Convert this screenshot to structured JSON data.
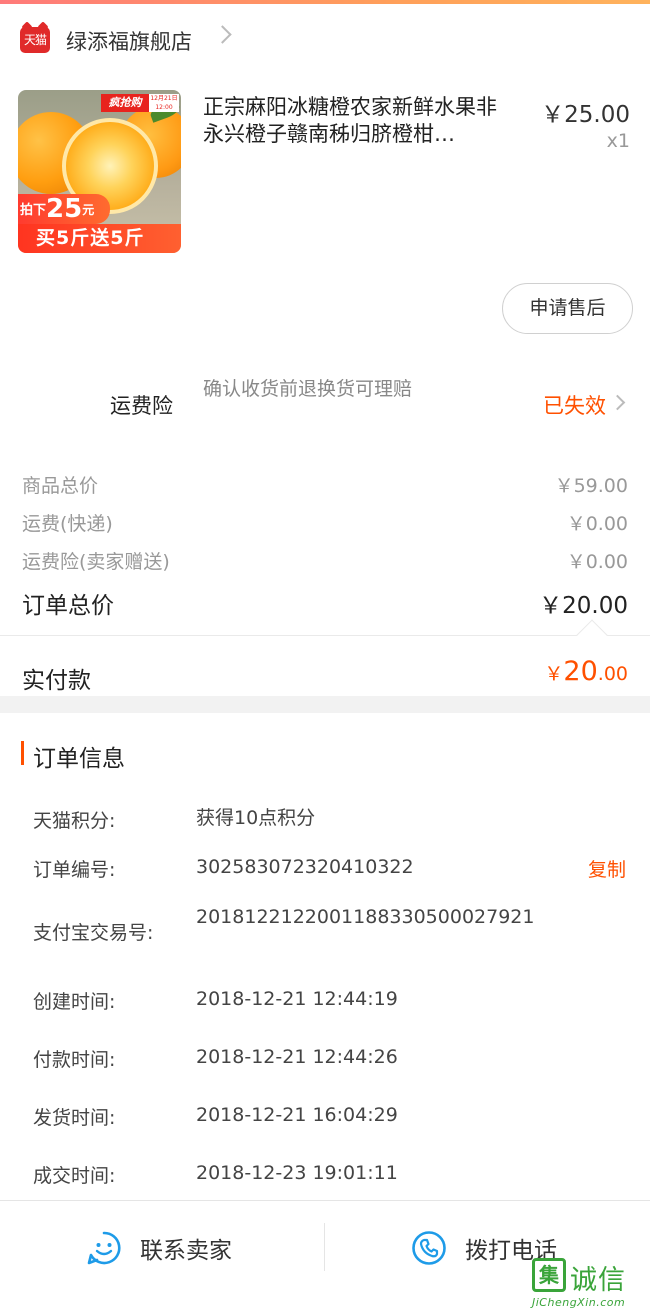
{
  "shop": {
    "logo_text": "天猫",
    "name": "绿添福旗舰店"
  },
  "product": {
    "image": {
      "badge": "疯抢购",
      "badge_date": "12月21日 12:00",
      "tag_prefix": "拍下",
      "tag_price": "25",
      "tag_unit": "元",
      "strip": "买5斤送5斤"
    },
    "title": "正宗麻阳冰糖橙农家新鲜水果非永兴橙子赣南秭归脐橙柑…",
    "unit_price": "￥25.00",
    "quantity": "x1"
  },
  "actions": {
    "after_sale": "申请售后"
  },
  "insurance": {
    "label": "运费险",
    "description": "确认收货前退换货可理赔",
    "status": "已失效"
  },
  "summary": {
    "rows": [
      {
        "label": "商品总价",
        "value": "￥59.00"
      },
      {
        "label": "运费(快递)",
        "value": "￥0.00"
      },
      {
        "label": "运费险(卖家赠送)",
        "value": "￥0.00"
      }
    ],
    "total_label": "订单总价",
    "total_value": "￥20.00",
    "paid_label": "实付款",
    "paid_currency": "￥",
    "paid_int": "20",
    "paid_dec": ".00"
  },
  "order_info": {
    "title": "订单信息",
    "rows": [
      {
        "label": "天猫积分:",
        "value": "获得10点积分"
      },
      {
        "label": "订单编号:",
        "value": "302583072320410322"
      },
      {
        "label": "支付宝交易号:",
        "value": "2018122122001188330500027921"
      },
      {
        "label": "创建时间:",
        "value": "2018-12-21 12:44:19"
      },
      {
        "label": "付款时间:",
        "value": "2018-12-21 12:44:26"
      },
      {
        "label": "发货时间:",
        "value": "2018-12-21 16:04:29"
      },
      {
        "label": "成交时间:",
        "value": "2018-12-23 19:01:11"
      }
    ],
    "copy": "复制"
  },
  "bottom": {
    "contact": "联系卖家",
    "call": "拨打电话"
  },
  "watermark": {
    "logo": "集",
    "text": "诚信",
    "url": "JiChengXin.com"
  },
  "colors": {
    "accent": "#ff5000",
    "tmall_red": "#e02a2a",
    "muted": "#999999",
    "watermark_green": "#3aa43a"
  }
}
